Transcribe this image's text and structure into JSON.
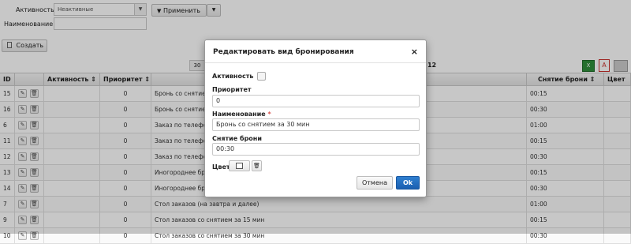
{
  "filters": {
    "activity_label": "Активность",
    "activity_value": "Неактивные",
    "apply_label": "Применить",
    "name_label": "Наименование",
    "name_value": ""
  },
  "toolbar": {
    "create_label": "Создать"
  },
  "pager": {
    "page_size": "30",
    "total_text": ": 12"
  },
  "table": {
    "columns": [
      "ID",
      "",
      "Активность",
      "Приоритет",
      "",
      "Снятие брони",
      "Цвет"
    ],
    "rows": [
      {
        "id": "15",
        "priority": "0",
        "name": "Бронь со снятием за 15 мин",
        "hold": "00:15"
      },
      {
        "id": "16",
        "priority": "0",
        "name": "Бронь со снятием за 30 мин",
        "hold": "00:30"
      },
      {
        "id": "6",
        "priority": "0",
        "name": "Заказ по телефону",
        "hold": "01:00"
      },
      {
        "id": "11",
        "priority": "0",
        "name": "Заказ по телефону",
        "hold": "00:15"
      },
      {
        "id": "12",
        "priority": "0",
        "name": "Заказ по телефону",
        "hold": "00:30"
      },
      {
        "id": "13",
        "priority": "0",
        "name": "Иногороднее бронирование",
        "hold": "00:15"
      },
      {
        "id": "14",
        "priority": "0",
        "name": "Иногороднее бронирование",
        "hold": "00:30"
      },
      {
        "id": "7",
        "priority": "0",
        "name": "Стол заказов (на завтра и далее)",
        "hold": "01:00"
      },
      {
        "id": "9",
        "priority": "0",
        "name": "Стол заказов со снятием за 15 мин",
        "hold": "00:15"
      },
      {
        "id": "10",
        "priority": "0",
        "name": "Стол заказов со снятием за 30 мин",
        "hold": "00:30"
      }
    ]
  },
  "dialog": {
    "title": "Редактировать вид бронирования",
    "close": "×",
    "activity_label": "Активность",
    "priority_label": "Приоритет",
    "priority_value": "0",
    "name_label": "Наименование",
    "required_mark": "*",
    "name_value": "Бронь со снятием за 30 мин",
    "hold_label": "Снятие брони",
    "hold_value": "00:30",
    "color_label": "Цвет",
    "cancel_label": "Отмена",
    "ok_label": "Ok"
  },
  "colors": {
    "ok_button": "#1a5fb0",
    "required": "#d9534f"
  }
}
